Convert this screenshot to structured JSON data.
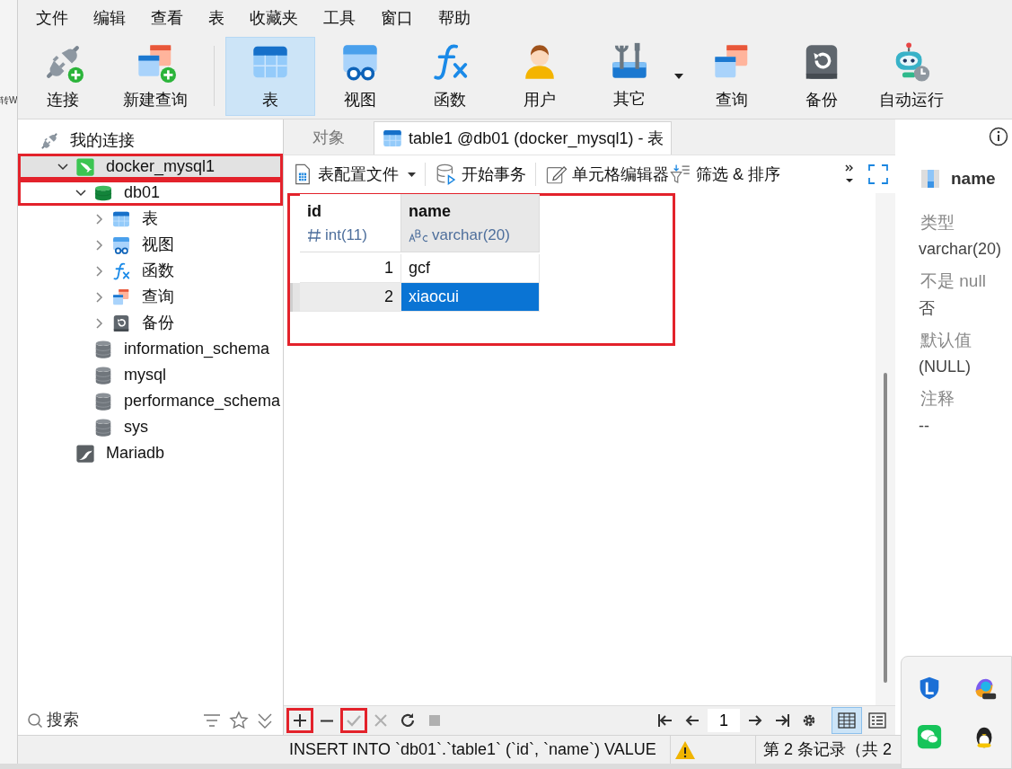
{
  "background_window": {
    "text": "转W"
  },
  "menu": [
    {
      "label": "文件"
    },
    {
      "label": "编辑"
    },
    {
      "label": "查看"
    },
    {
      "label": "表"
    },
    {
      "label": "收藏夹"
    },
    {
      "label": "工具"
    },
    {
      "label": "窗口"
    },
    {
      "label": "帮助"
    }
  ],
  "toolbar": {
    "groups": [
      [
        {
          "label": "连接",
          "kind": "plug",
          "selected": false,
          "dropdown": false
        },
        {
          "label": "新建查询",
          "kind": "new-query",
          "selected": false,
          "dropdown": false
        }
      ],
      [
        {
          "label": "表",
          "kind": "table",
          "selected": true,
          "dropdown": false
        },
        {
          "label": "视图",
          "kind": "view",
          "selected": false,
          "dropdown": false
        },
        {
          "label": "函数",
          "kind": "function",
          "selected": false,
          "dropdown": false
        },
        {
          "label": "用户",
          "kind": "user",
          "selected": false,
          "dropdown": false
        },
        {
          "label": "其它",
          "kind": "tools",
          "selected": false,
          "dropdown": true
        },
        {
          "label": "查询",
          "kind": "query",
          "selected": false,
          "dropdown": false
        },
        {
          "label": "备份",
          "kind": "backup",
          "selected": false,
          "dropdown": false
        },
        {
          "label": "自动运行",
          "kind": "robot",
          "selected": false,
          "dropdown": false
        }
      ]
    ]
  },
  "tree": [
    {
      "label": "我的连接",
      "kind": "plug",
      "children": [
        {
          "label": "docker_mysql1",
          "kind": "mysql",
          "expanded": true,
          "selected": true,
          "highlighted": true,
          "children": [
            {
              "label": "db01",
              "kind": "db-open",
              "expanded": true,
              "selected": false,
              "highlighted": true,
              "children": [
                {
                  "label": "表",
                  "kind": "table",
                  "expanded": false,
                  "selected": false,
                  "highlighted": false
                },
                {
                  "label": "视图",
                  "kind": "view",
                  "expanded": false,
                  "selected": false,
                  "highlighted": false
                },
                {
                  "label": "函数",
                  "kind": "function",
                  "expanded": false,
                  "selected": false,
                  "highlighted": false
                },
                {
                  "label": "查询",
                  "kind": "query",
                  "expanded": false,
                  "selected": false,
                  "highlighted": false
                },
                {
                  "label": "备份",
                  "kind": "backup",
                  "expanded": false,
                  "selected": false,
                  "highlighted": false
                }
              ]
            },
            {
              "label": "information_schema",
              "kind": "db",
              "selected": false,
              "highlighted": false
            },
            {
              "label": "mysql",
              "kind": "db",
              "selected": false,
              "highlighted": false
            },
            {
              "label": "performance_schema",
              "kind": "db",
              "selected": false,
              "highlighted": false
            },
            {
              "label": "sys",
              "kind": "db",
              "selected": false,
              "highlighted": false
            }
          ]
        },
        {
          "label": "Mariadb",
          "kind": "mariadb",
          "selected": false,
          "highlighted": false
        }
      ]
    }
  ],
  "search": {
    "placeholder": "搜索"
  },
  "tabs": [
    {
      "label": "对象",
      "kind": "objects",
      "selected": false
    },
    {
      "label": "table1 @db01 (docker_mysql1) - 表",
      "kind": "table",
      "selected": true
    }
  ],
  "grid_toolbar": [
    {
      "label": "表配置文件",
      "kind": "profile",
      "dropdown": true
    },
    {
      "label": "开始事务",
      "kind": "transaction",
      "dropdown": false
    },
    {
      "label": "单元格编辑器",
      "kind": "cell-editor",
      "dropdown": false
    },
    {
      "label": "筛选 & 排序",
      "kind": "filter",
      "dropdown": false
    }
  ],
  "grid": {
    "highlighted": true,
    "columns": [
      {
        "name": "id",
        "type": "int(11)",
        "kind": "number"
      },
      {
        "name": "name",
        "type": "varchar(20)",
        "kind": "text"
      }
    ],
    "rows": [
      {
        "current": false,
        "cells": [
          {
            "value": "1",
            "selected": false
          },
          {
            "value": "gcf",
            "selected": false
          }
        ]
      },
      {
        "current": true,
        "cells": [
          {
            "value": "2",
            "selected": false
          },
          {
            "value": "xiaocui",
            "selected": true
          }
        ]
      }
    ]
  },
  "bottom_toolbar": {
    "actions": [
      {
        "kind": "add",
        "highlighted": true,
        "disabled": false
      },
      {
        "kind": "remove",
        "highlighted": false,
        "disabled": false
      },
      {
        "kind": "apply",
        "highlighted": true,
        "disabled": true
      },
      {
        "kind": "discard",
        "highlighted": false,
        "disabled": true
      },
      {
        "kind": "refresh",
        "highlighted": false,
        "disabled": false
      },
      {
        "kind": "stop",
        "highlighted": false,
        "disabled": true
      }
    ],
    "page": "1",
    "views": [
      {
        "kind": "grid",
        "selected": true
      },
      {
        "kind": "form",
        "selected": false
      }
    ]
  },
  "status": {
    "sql": "INSERT INTO `db01`.`table1` (`id`, `name`) VALUE",
    "warning": true,
    "record": "第 2 条记录（共 2"
  },
  "info_panel": {
    "title": "name",
    "fields": [
      {
        "label": "类型",
        "value": "varchar(20)"
      },
      {
        "label": "不是 null",
        "value": "否"
      },
      {
        "label": "默认值",
        "value": "(NULL)"
      },
      {
        "label": "注释",
        "value": "--"
      }
    ]
  },
  "tray": [
    {
      "kind": "shield"
    },
    {
      "kind": "office"
    },
    {
      "kind": "chat"
    },
    {
      "kind": "penguin"
    }
  ]
}
